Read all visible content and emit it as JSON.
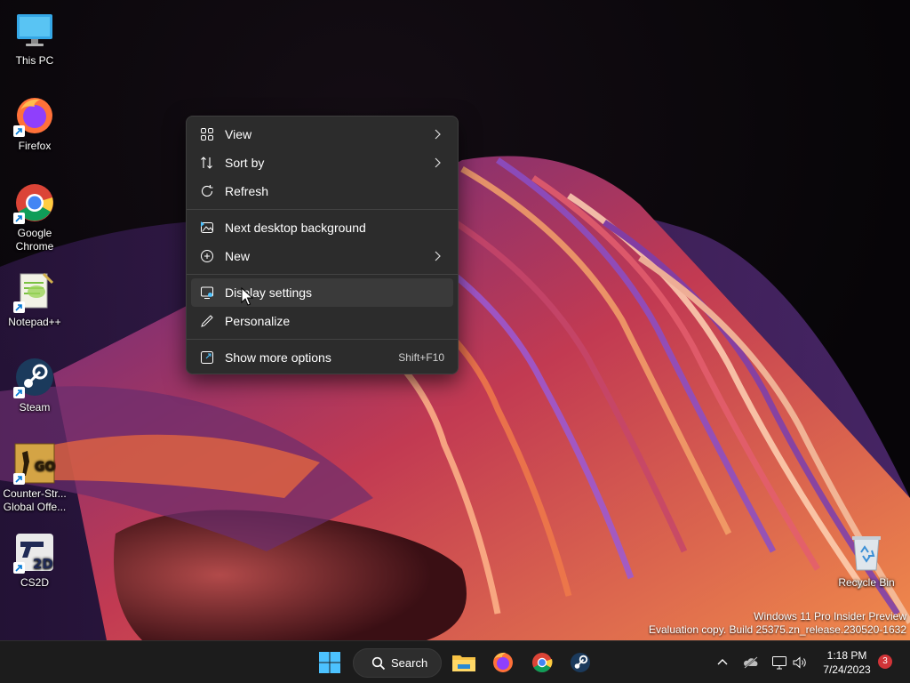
{
  "desktop_icons": [
    {
      "label": "This PC",
      "icon": "monitor-icon"
    },
    {
      "label": "Firefox",
      "icon": "firefox-icon"
    },
    {
      "label": "Google Chrome",
      "icon": "chrome-icon"
    },
    {
      "label": "Notepad++",
      "icon": "notepad-plus-plus-icon"
    },
    {
      "label": "Steam",
      "icon": "steam-icon"
    },
    {
      "label": "Counter-Str...\nGlobal Offe...",
      "icon": "csgo-icon"
    },
    {
      "label": "CS2D",
      "icon": "cs2d-icon"
    },
    {
      "label": "Recycle Bin",
      "icon": "recycle-bin-icon"
    }
  ],
  "context_menu": {
    "items": [
      {
        "label": "View",
        "icon": "grid-view-icon",
        "submenu": true
      },
      {
        "label": "Sort by",
        "icon": "sort-icon",
        "submenu": true
      },
      {
        "label": "Refresh",
        "icon": "refresh-icon",
        "submenu": false
      },
      {
        "label": "Next desktop background",
        "icon": "next-background-icon",
        "submenu": false
      },
      {
        "label": "New",
        "icon": "plus-circle-icon",
        "submenu": true
      },
      {
        "label": "Display settings",
        "icon": "display-icon",
        "submenu": false,
        "hovered": true
      },
      {
        "label": "Personalize",
        "icon": "pen-icon",
        "submenu": false
      },
      {
        "label": "Show more options",
        "icon": "more-options-icon",
        "submenu": false,
        "accelerator": "Shift+F10"
      }
    ]
  },
  "watermark": {
    "line1": "Windows 11 Pro Insider Preview",
    "line2": "Evaluation copy. Build 25375.zn_release.230520-1632"
  },
  "taskbar": {
    "search_label": "Search",
    "apps": [
      "start-icon",
      "file-explorer-icon",
      "firefox-icon",
      "chrome-icon",
      "steam-icon"
    ],
    "tray_icons": [
      "chevron-up-icon",
      "onedrive-icon",
      "network-icon",
      "volume-icon"
    ],
    "time": "1:18 PM",
    "date": "7/24/2023",
    "notification_count": "3"
  },
  "colors": {
    "menu_bg": "#2c2c2c",
    "menu_hover": "#3a3a3a",
    "taskbar_bg": "#1c1c1c",
    "accent_blue": "#0078d4",
    "notification_badge": "#d13438"
  }
}
